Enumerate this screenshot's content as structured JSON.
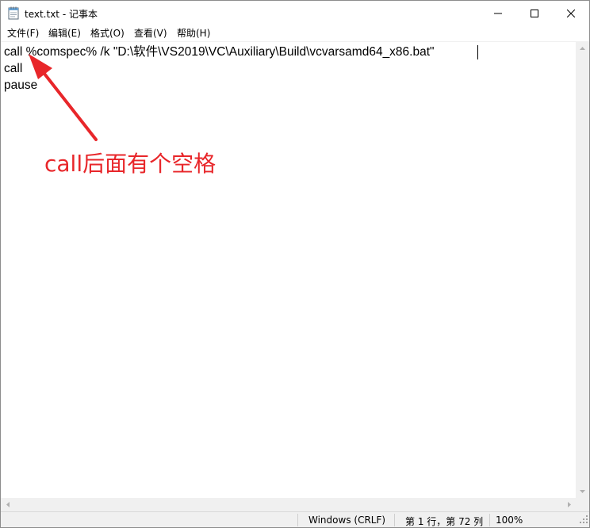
{
  "window": {
    "title": "text.txt - 记事本"
  },
  "menu": {
    "items": [
      "文件(F)",
      "编辑(E)",
      "格式(O)",
      "查看(V)",
      "帮助(H)"
    ]
  },
  "editor": {
    "lines": [
      "call %comspec% /k \"D:\\软件\\VS2019\\VC\\Auxiliary\\Build\\vcvarsamd64_x86.bat\"",
      "call",
      "pause"
    ]
  },
  "annotation": {
    "text": "call后面有个空格",
    "color": "#e8262a"
  },
  "status": {
    "encoding": "Windows (CRLF)",
    "position": "第 1 行，第 72 列",
    "zoom": "100%"
  },
  "icons": {
    "app": "notepad-icon",
    "minimize": "minimize-icon",
    "maximize": "maximize-icon",
    "close": "close-icon"
  }
}
